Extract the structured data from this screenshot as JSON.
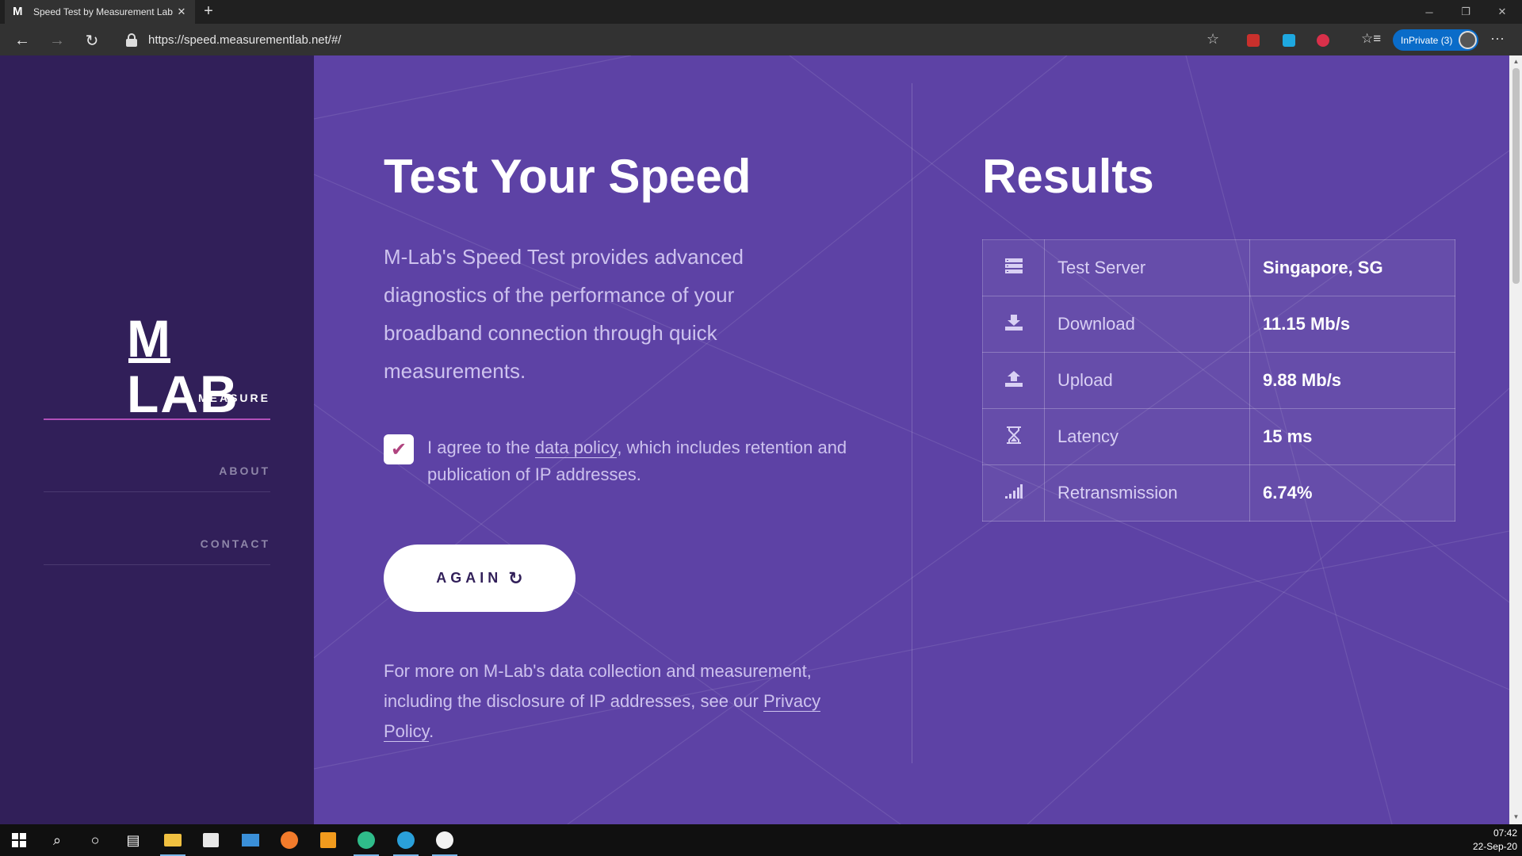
{
  "browser": {
    "tab_title": "Speed Test by Measurement Lab",
    "favicon_letter": "M",
    "url": "https://speed.measurementlab.net/#/",
    "inprivate_label": "InPrivate (3)"
  },
  "sidebar": {
    "logo_text": "MLAB",
    "nav": [
      {
        "label": "MEASURE",
        "active": true
      },
      {
        "label": "ABOUT",
        "active": false
      },
      {
        "label": "CONTACT",
        "active": false
      }
    ]
  },
  "main": {
    "title": "Test Your Speed",
    "description": "M-Lab's Speed Test provides advanced diagnostics of the performance of your broadband connection through quick measurements.",
    "agree_prefix": "I agree to the ",
    "agree_link": "data policy",
    "agree_suffix": ", which includes retention and publication of IP addresses.",
    "agree_checked": true,
    "button_label": "AGAIN",
    "footnote_prefix": "For more on M-Lab's data collection and measurement, including the disclosure of IP addresses, see our ",
    "footnote_link": "Privacy Policy",
    "footnote_suffix": "."
  },
  "results": {
    "title": "Results",
    "rows": [
      {
        "icon": "server-icon",
        "label": "Test Server",
        "value": "Singapore, SG"
      },
      {
        "icon": "download-icon",
        "label": "Download",
        "value": "11.15 Mb/s"
      },
      {
        "icon": "upload-icon",
        "label": "Upload",
        "value": "9.88 Mb/s"
      },
      {
        "icon": "hourglass-icon",
        "label": "Latency",
        "value": "15 ms"
      },
      {
        "icon": "signal-icon",
        "label": "Retransmission",
        "value": "6.74%"
      }
    ]
  },
  "taskbar": {
    "time": "07:42",
    "date": "22-Sep-20"
  },
  "colors": {
    "sidebar_bg": "#311f59",
    "main_bg": "#5d42a5",
    "accent": "#b04fb9"
  }
}
